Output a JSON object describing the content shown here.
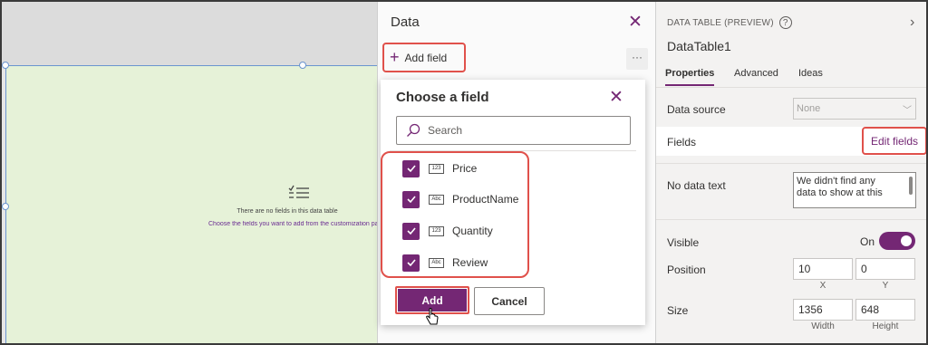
{
  "canvas": {
    "empty_message": "There are no fields in this data table",
    "empty_hint": "Choose the fields you want to add from the customization pane"
  },
  "data_pane": {
    "title": "Data",
    "add_field_label": "Add field",
    "more_label": "···"
  },
  "chooser": {
    "title": "Choose a field",
    "search_placeholder": "Search",
    "fields": [
      {
        "type_badge": "123",
        "label": "Price",
        "checked": true
      },
      {
        "type_badge": "Abc",
        "label": "ProductName",
        "checked": true
      },
      {
        "type_badge": "123",
        "label": "Quantity",
        "checked": true
      },
      {
        "type_badge": "Abc",
        "label": "Review",
        "checked": true
      }
    ],
    "add_label": "Add",
    "cancel_label": "Cancel"
  },
  "properties": {
    "heading": "DATA TABLE (PREVIEW)",
    "help_label": "?",
    "control_name": "DataTable1",
    "tabs": [
      "Properties",
      "Advanced",
      "Ideas"
    ],
    "data_source_label": "Data source",
    "data_source_value": "None",
    "fields_label": "Fields",
    "edit_fields_label": "Edit fields",
    "no_data_text_label": "No data text",
    "no_data_text_value": "We didn't find any data to show at this",
    "visible_label": "Visible",
    "visible_state": "On",
    "position_label": "Position",
    "position_x": "10",
    "position_y": "0",
    "x_caption": "X",
    "y_caption": "Y",
    "size_label": "Size",
    "size_width": "1356",
    "size_height": "648",
    "width_caption": "Width",
    "height_caption": "Height"
  },
  "colors": {
    "accent": "#742774",
    "highlight": "#e0514b",
    "canvas_fill": "#e6f2d8"
  }
}
